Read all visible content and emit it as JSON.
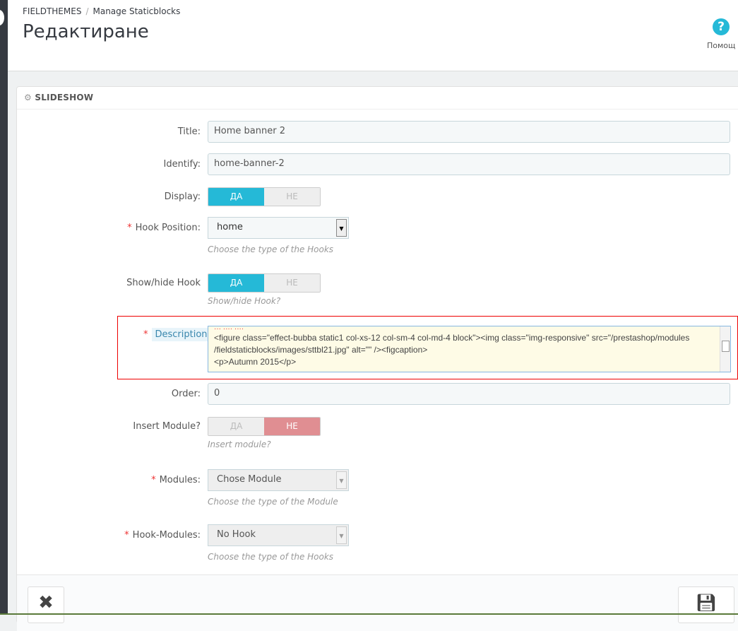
{
  "breadcrumb": {
    "parent": "FIELDTHEMES",
    "current": "Manage Staticblocks"
  },
  "page_title": "Редактиране",
  "help": {
    "label": "Помощ",
    "icon": "question-circle-icon"
  },
  "panel": {
    "title": "SLIDESHOW",
    "icon": "gear-icon"
  },
  "form": {
    "title": {
      "label": "Title:",
      "value": "Home banner 2"
    },
    "identify": {
      "label": "Identify:",
      "value": "home-banner-2"
    },
    "display": {
      "label": "Display:",
      "yes": "ДА",
      "no": "НЕ",
      "value": "yes"
    },
    "hook_position": {
      "label": "Hook Position:",
      "value": "home",
      "help": "Choose the type of the Hooks"
    },
    "show_hide_hook": {
      "label": "Show/hide Hook",
      "yes": "ДА",
      "no": "НЕ",
      "value": "yes",
      "help": "Show/hide Hook?"
    },
    "description": {
      "label": "Description",
      "lines": [
        "<figure class=\"effect-bubba static1 col-xs-12 col-sm-4 col-md-4 block\"><img class=\"img-responsive\" src=\"/prestashop/modules",
        "/fieldstaticblocks/images/sttbl21.jpg\" alt=\"\" /><figcaption>",
        "<p>Autumn 2015</p>"
      ]
    },
    "order": {
      "label": "Order:",
      "value": "0"
    },
    "insert_module": {
      "label": "Insert Module?",
      "yes": "ДА",
      "no": "НЕ",
      "value": "no",
      "help": "Insert module?"
    },
    "modules": {
      "label": "Modules:",
      "value": "Chose Module",
      "help": "Choose the type of the Module"
    },
    "hook_modules": {
      "label": "Hook-Modules:",
      "value": "No Hook",
      "help": "Choose the type of the Hooks"
    }
  },
  "footer": {
    "cancel_icon": "close-icon",
    "save_icon": "floppy-disk-icon"
  },
  "colors": {
    "accent": "#25b9d7",
    "danger": "#e08e92",
    "highlight_border": "#ee0000"
  }
}
